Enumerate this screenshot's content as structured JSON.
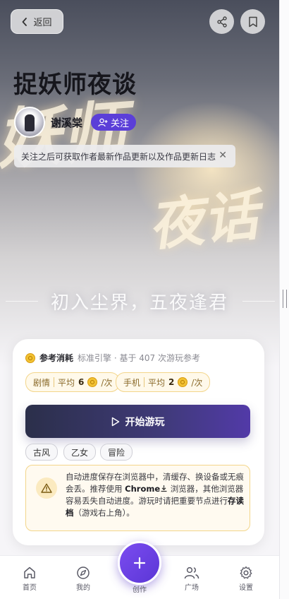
{
  "header": {
    "back_label": "返回",
    "share_icon": "share-icon",
    "bookmark_icon": "bookmark-icon"
  },
  "hero": {
    "brush_text_1": "妖师",
    "brush_text_2": "夜话",
    "subtitle": "初入尘界，五夜逢君"
  },
  "story": {
    "title": "捉妖师夜谈",
    "author": "谢溪棠",
    "follow_label": "关注"
  },
  "tip": {
    "text": "关注之后可获取作者最新作品更新以及作品更新日志"
  },
  "cost": {
    "label": "参考消耗",
    "sub": "标准引擎 · 基于 407 次游玩参考",
    "pills": [
      {
        "name": "剧情",
        "prefix": "平均",
        "value": "6",
        "suffix": "/次"
      },
      {
        "name": "手机",
        "prefix": "平均",
        "value": "2",
        "suffix": "/次"
      }
    ]
  },
  "start_label": "开始游玩",
  "tags": [
    "古风",
    "乙女",
    "冒险"
  ],
  "warning": {
    "part1": "自动进度保存在浏览器中，清缓存、换设备或无痕会丢。推荐使用 ",
    "chrome": "Chrome",
    "part2": " 浏览器，其他浏览器容易丢失自动进度。游玩时请把重要节点进行",
    "bold": "存读档",
    "part3": "（游戏右上角）。"
  },
  "nav": {
    "home": "首页",
    "mine": "我的",
    "create": "创作",
    "plaza": "广场",
    "settings": "设置"
  },
  "colors": {
    "accent": "#5b3fd8",
    "start_button": "#3f3a78",
    "warning_border": "#f3d58a",
    "coin": "#f2c233"
  }
}
